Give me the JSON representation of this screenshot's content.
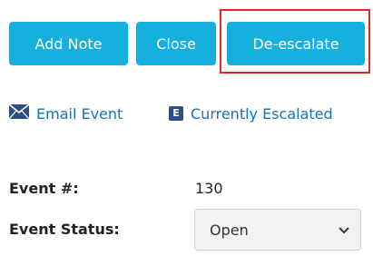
{
  "toolbar": {
    "add_note": "Add Note",
    "close": "Close",
    "deescalate": "De-escalate"
  },
  "links": {
    "email": "Email Event",
    "escalated": "Currently Escalated",
    "escalated_badge": "E"
  },
  "fields": {
    "event_label": "Event #:",
    "event_value": "130",
    "status_label": "Event Status:",
    "status_value": "Open"
  },
  "colors": {
    "button_bg": "#17b0de",
    "link": "#1573b9",
    "highlight": "#e0292a"
  },
  "icons": {
    "email": "envelope-icon",
    "escalated": "escalated-badge-icon",
    "select": "chevron-down-icon"
  }
}
